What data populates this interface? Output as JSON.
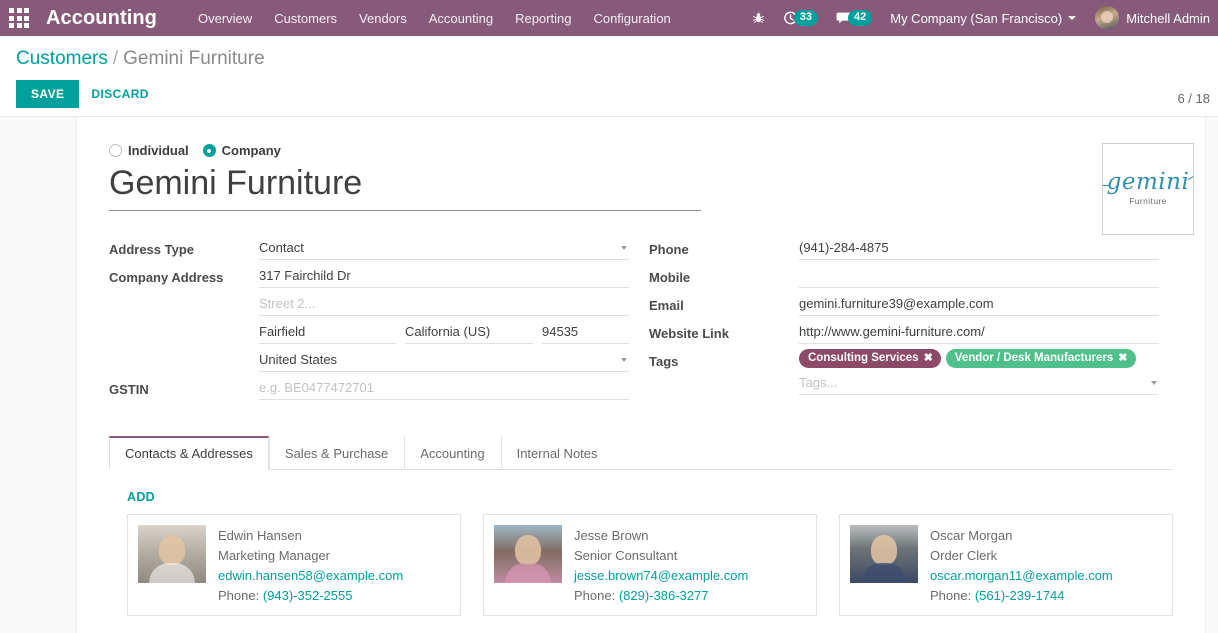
{
  "navbar": {
    "apps_icon": "apps-grid-icon",
    "brand": "Accounting",
    "menu": [
      "Overview",
      "Customers",
      "Vendors",
      "Accounting",
      "Reporting",
      "Configuration"
    ],
    "bug_icon": "bug-icon",
    "activity_icon": "clock-activity-icon",
    "activity_count": "33",
    "messages_icon": "chat-bubble-icon",
    "messages_count": "42",
    "company": "My Company (San Francisco)",
    "user_name": "Mitchell Admin",
    "bg_color": "#875A7B",
    "badge_color": "#00A09D"
  },
  "control_panel": {
    "breadcrumb_root": "Customers",
    "breadcrumb_sep": "/",
    "breadcrumb_current": "Gemini Furniture",
    "save_label": "SAVE",
    "discard_label": "DISCARD",
    "pager": "6 / 18",
    "accent_color": "#00A09D"
  },
  "form": {
    "partner_type": {
      "individual_label": "Individual",
      "company_label": "Company",
      "selected": "Company"
    },
    "name": "Gemini Furniture",
    "logo": {
      "script_text": "gemini",
      "sub_text": "Furniture",
      "color": "#2F8FA8"
    },
    "left_fields": {
      "address_type_label": "Address Type",
      "address_type_value": "Contact",
      "company_address_label": "Company Address",
      "street": "317 Fairchild Dr",
      "street2_placeholder": "Street 2...",
      "city": "Fairfield",
      "state": "California (US)",
      "zip": "94535",
      "country": "United States",
      "gstin_label": "GSTIN",
      "gstin_placeholder": "e.g. BE0477472701"
    },
    "right_fields": {
      "phone_label": "Phone",
      "phone_value": "(941)-284-4875",
      "mobile_label": "Mobile",
      "mobile_value": "",
      "email_label": "Email",
      "email_value": "gemini.furniture39@example.com",
      "website_label": "Website Link",
      "website_value": "http://www.gemini-furniture.com/",
      "tags_label": "Tags",
      "tags_placeholder": "Tags...",
      "tags": [
        {
          "label": "Consulting Services",
          "color": "#8D4A66",
          "remove": "✖"
        },
        {
          "label": "Vendor / Desk Manufacturers",
          "color": "#50C08A",
          "remove": "✖"
        }
      ]
    }
  },
  "notebook": {
    "tabs": [
      {
        "label": "Contacts & Addresses",
        "active": true
      },
      {
        "label": "Sales & Purchase",
        "active": false
      },
      {
        "label": "Accounting",
        "active": false
      },
      {
        "label": "Internal Notes",
        "active": false
      }
    ],
    "add_label": "ADD",
    "contacts": [
      {
        "name": "Edwin Hansen",
        "role": "Marketing Manager",
        "email": "edwin.hansen58@example.com",
        "phone_prefix": "Phone:",
        "phone": "(943)-352-2555"
      },
      {
        "name": "Jesse Brown",
        "role": "Senior Consultant",
        "email": "jesse.brown74@example.com",
        "phone_prefix": "Phone:",
        "phone": "(829)-386-3277"
      },
      {
        "name": "Oscar Morgan",
        "role": "Order Clerk",
        "email": "oscar.morgan11@example.com",
        "phone_prefix": "Phone:",
        "phone": "(561)-239-1744"
      }
    ]
  }
}
